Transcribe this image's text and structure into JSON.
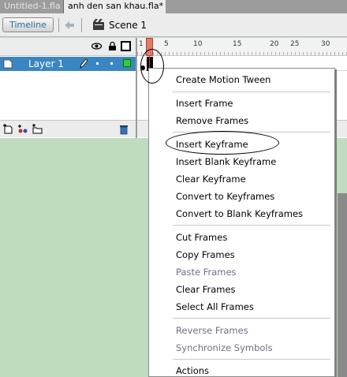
{
  "tabs": [
    "Untitled-1.fla",
    "anh den san khau.fla*"
  ],
  "toolbar": {
    "timeline_label": "Timeline",
    "scene_label": "Scene 1"
  },
  "timeline": {
    "ruler_ticks": [
      "1",
      "5",
      "10",
      "15",
      "20",
      "25",
      "30"
    ],
    "layer_name": "Layer 1"
  },
  "context_menu": {
    "groups": [
      [
        "Create Motion Tween"
      ],
      [
        "Insert Frame",
        "Remove Frames"
      ],
      [
        "Insert Keyframe",
        "Insert Blank Keyframe",
        "Clear Keyframe",
        "Convert to Keyframes",
        "Convert to Blank Keyframes"
      ],
      [
        "Cut Frames",
        "Copy Frames",
        "Paste Frames",
        "Clear Frames",
        "Select All Frames"
      ],
      [
        "Reverse Frames",
        "Synchronize Symbols"
      ],
      [
        "Actions"
      ]
    ],
    "items": {
      "create_motion_tween": "Create Motion Tween",
      "insert_frame": "Insert Frame",
      "remove_frames": "Remove Frames",
      "insert_keyframe": "Insert Keyframe",
      "insert_blank_keyframe": "Insert Blank Keyframe",
      "clear_keyframe": "Clear Keyframe",
      "convert_to_keyframes": "Convert to Keyframes",
      "convert_to_blank_keyframes": "Convert to Blank Keyframes",
      "cut_frames": "Cut Frames",
      "copy_frames": "Copy Frames",
      "paste_frames": "Paste Frames",
      "clear_frames": "Clear Frames",
      "select_all_frames": "Select All Frames",
      "reverse_frames": "Reverse Frames",
      "synchronize_symbols": "Synchronize Symbols",
      "actions": "Actions"
    },
    "disabled": [
      "Paste Frames",
      "Reverse Frames",
      "Synchronize Symbols"
    ]
  },
  "colors": {
    "stage_bg": "#c0dcc0",
    "layer_selected": "#3a86c2",
    "playhead": "#e07a6a",
    "timeline_btn_text": "#2a6f9a"
  },
  "icons": [
    "eye-icon",
    "lock-icon",
    "outline-icon",
    "back-arrow-icon",
    "scene-icon",
    "pencil-icon",
    "add-layer-icon",
    "add-guide-icon",
    "add-folder-icon",
    "trash-icon"
  ]
}
